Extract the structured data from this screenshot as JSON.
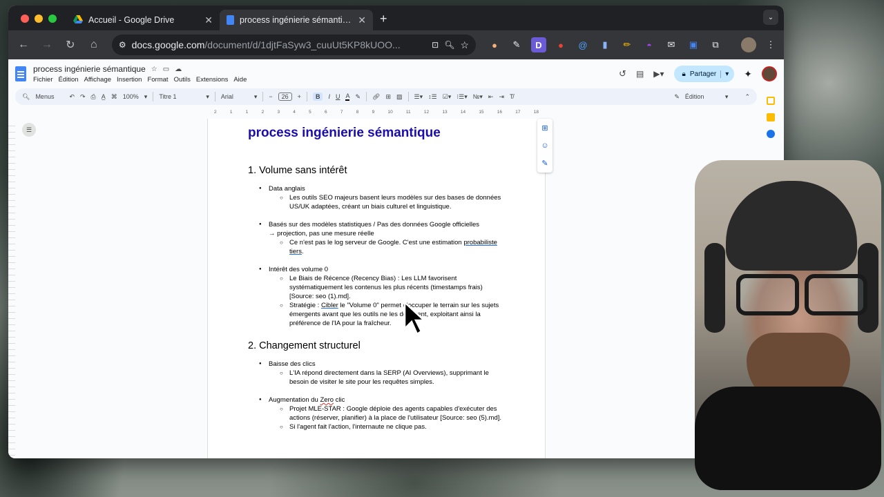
{
  "browser": {
    "tabs": [
      {
        "title": "Accueil - Google Drive",
        "active": false
      },
      {
        "title": "process ingénierie sémantique",
        "active": true
      }
    ],
    "new_tab": "+",
    "url_host": "docs.google.com",
    "url_path": "/document/d/1djtFaSyw3_cuuUt5KP8kUOO..."
  },
  "docs": {
    "title": "process ingénierie sémantique",
    "menus": [
      "Fichier",
      "Édition",
      "Affichage",
      "Insertion",
      "Format",
      "Outils",
      "Extensions",
      "Aide"
    ],
    "share_label": "Partager",
    "toolbar": {
      "search": "Menus",
      "zoom": "100%",
      "style": "Titre 1",
      "font": "Arial",
      "font_size": "26",
      "mode": "Édition"
    },
    "ruler": [
      "2",
      "1",
      "1",
      "2",
      "3",
      "4",
      "5",
      "6",
      "7",
      "8",
      "9",
      "10",
      "11",
      "12",
      "13",
      "14",
      "15",
      "16",
      "17",
      "18"
    ]
  },
  "document": {
    "heading": "process ingénierie sémantique",
    "section1_title": "1. Volume sans intérêt",
    "s1": {
      "b1": "Data anglais",
      "b1_sub1": "Les outils SEO majeurs basent leurs modèles sur des bases de données US/UK adaptées, créant un biais culturel et linguistique.",
      "b2": "Basés sur des modèles statistiques / Pas des données Google officielles → projection, pas une mesure réelle",
      "b2_sub1_a": "Ce n'est pas le log serveur de Google. C'est une estimation ",
      "b2_sub1_b": "probabiliste tiers",
      "b2_sub1_c": ".",
      "b3": "Intérêt des volume 0",
      "b3_sub1": "Le Biais de Récence (Recency Bias) : Les LLM favorisent systématiquement les contenus les plus récents (timestamps frais) [Source: seo (1).md].",
      "b3_sub2_a": "Stratégie : ",
      "b3_sub2_b": "Cibler",
      "b3_sub2_c": " le \"Volume 0\" permet d'occuper le terrain sur les sujets émergents avant que les outils ne les détectent, exploitant ainsi la préférence de l'IA pour la fraîcheur."
    },
    "section2_title": "2. Changement structurel",
    "s2": {
      "b1": "Baisse des clics",
      "b1_sub1": "L'IA répond directement dans la SERP (AI Overviews), supprimant le besoin de visiter le site pour les requêtes simples.",
      "b2_a": "Augmentation du ",
      "b2_b": "Zero",
      "b2_c": " clic",
      "b2_sub1": "Projet MLE-STAR : Google déploie des agents capables d'exécuter des actions (réserver, planifier) à la place de l'utilisateur [Source: seo (5).md].",
      "b2_sub2": "Si l'agent fait l'action, l'internaute ne clique pas."
    }
  },
  "colors": {
    "tab_bar": "#202124",
    "toolbar": "#35363a",
    "heading_blue": "#1a0dab",
    "share_bg": "#c2e7ff",
    "docs_blue": "#4285f4"
  }
}
